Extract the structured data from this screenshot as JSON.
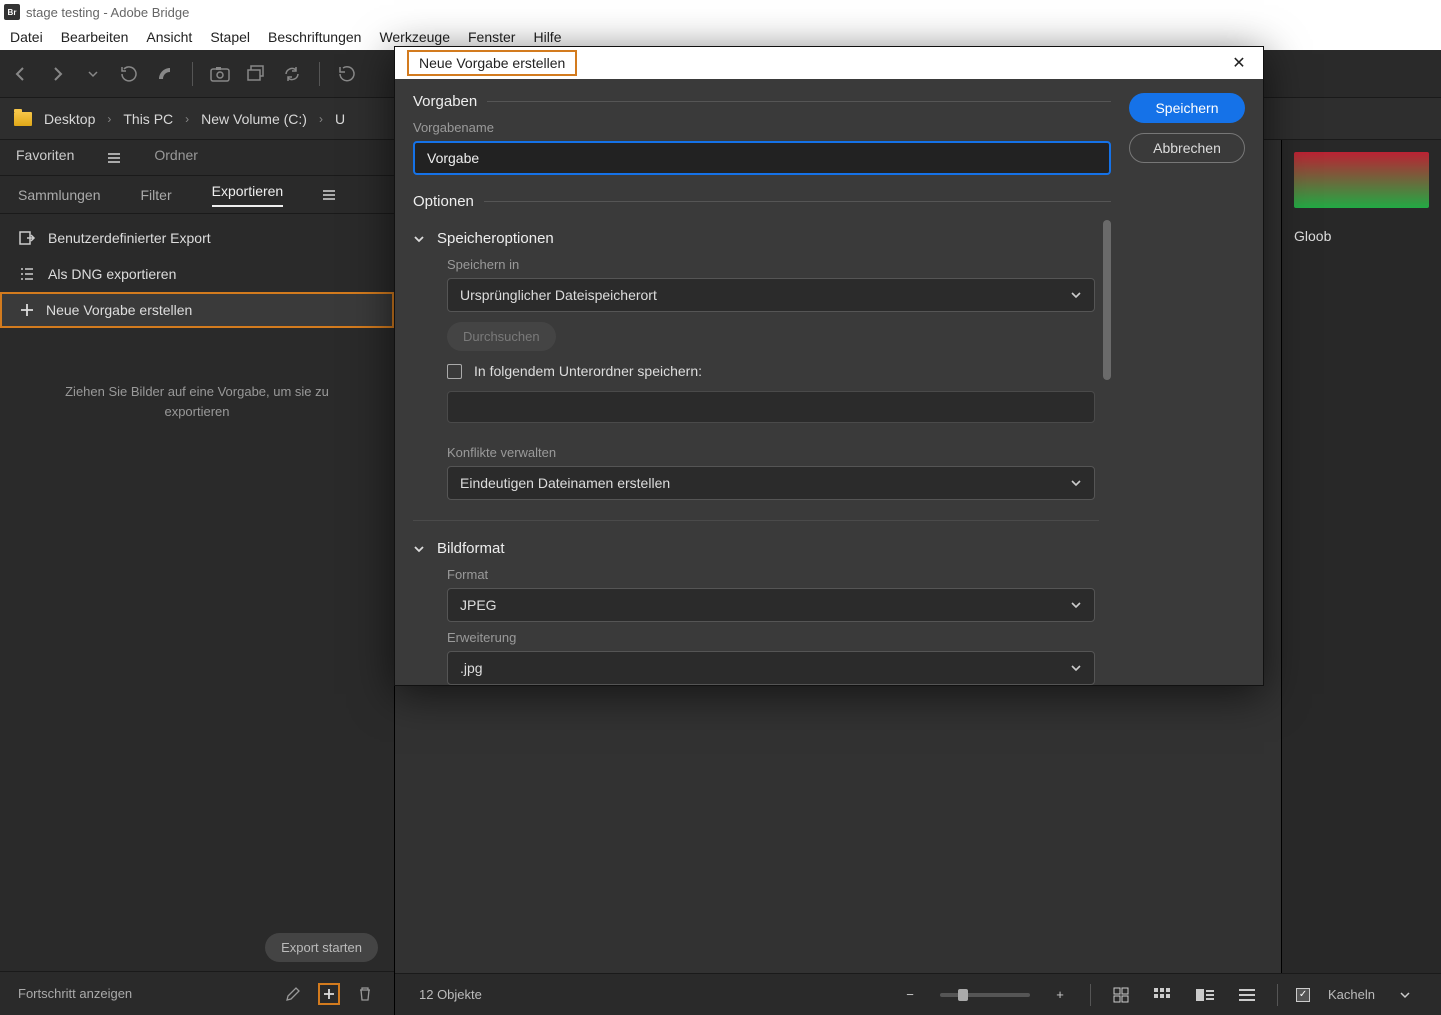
{
  "titlebar": {
    "text": "stage testing - Adobe Bridge",
    "app_badge": "Br"
  },
  "menubar": [
    "Datei",
    "Bearbeiten",
    "Ansicht",
    "Stapel",
    "Beschriftungen",
    "Werkzeuge",
    "Fenster",
    "Hilfe"
  ],
  "breadcrumb": [
    "Desktop",
    "This PC",
    "New Volume (C:)",
    "U"
  ],
  "left_tabs_top": {
    "a": "Favoriten",
    "b": "Ordner"
  },
  "left_tabs_bottom": {
    "a": "Sammlungen",
    "b": "Filter",
    "c": "Exportieren"
  },
  "export_items": {
    "custom": "Benutzerdefinierter Export",
    "dng": "Als DNG exportieren",
    "new": "Neue Vorgabe erstellen"
  },
  "export_hint": "Ziehen Sie Bilder auf eine Vorgabe, um sie zu exportieren",
  "export_start_btn": "Export starten",
  "progress_label": "Fortschritt anzeigen",
  "footer": {
    "objects": "12 Objekte",
    "tiles": "Kacheln"
  },
  "right": {
    "label": "Gloob"
  },
  "dialog": {
    "title": "Neue Vorgabe erstellen",
    "save": "Speichern",
    "cancel": "Abbrechen",
    "sec_vorgaben": "Vorgaben",
    "name_label": "Vorgabename",
    "name_value": "Vorgabe",
    "sec_optionen": "Optionen",
    "group_save": "Speicheroptionen",
    "save_in_label": "Speichern in",
    "save_in_value": "Ursprünglicher Dateispeicherort",
    "browse": "Durchsuchen",
    "subfolder_label": "In folgendem Unterordner speichern:",
    "conflict_label": "Konflikte verwalten",
    "conflict_value": "Eindeutigen Dateinamen erstellen",
    "group_format": "Bildformat",
    "format_label": "Format",
    "format_value": "JPEG",
    "ext_label": "Erweiterung",
    "ext_value": ".jpg"
  }
}
